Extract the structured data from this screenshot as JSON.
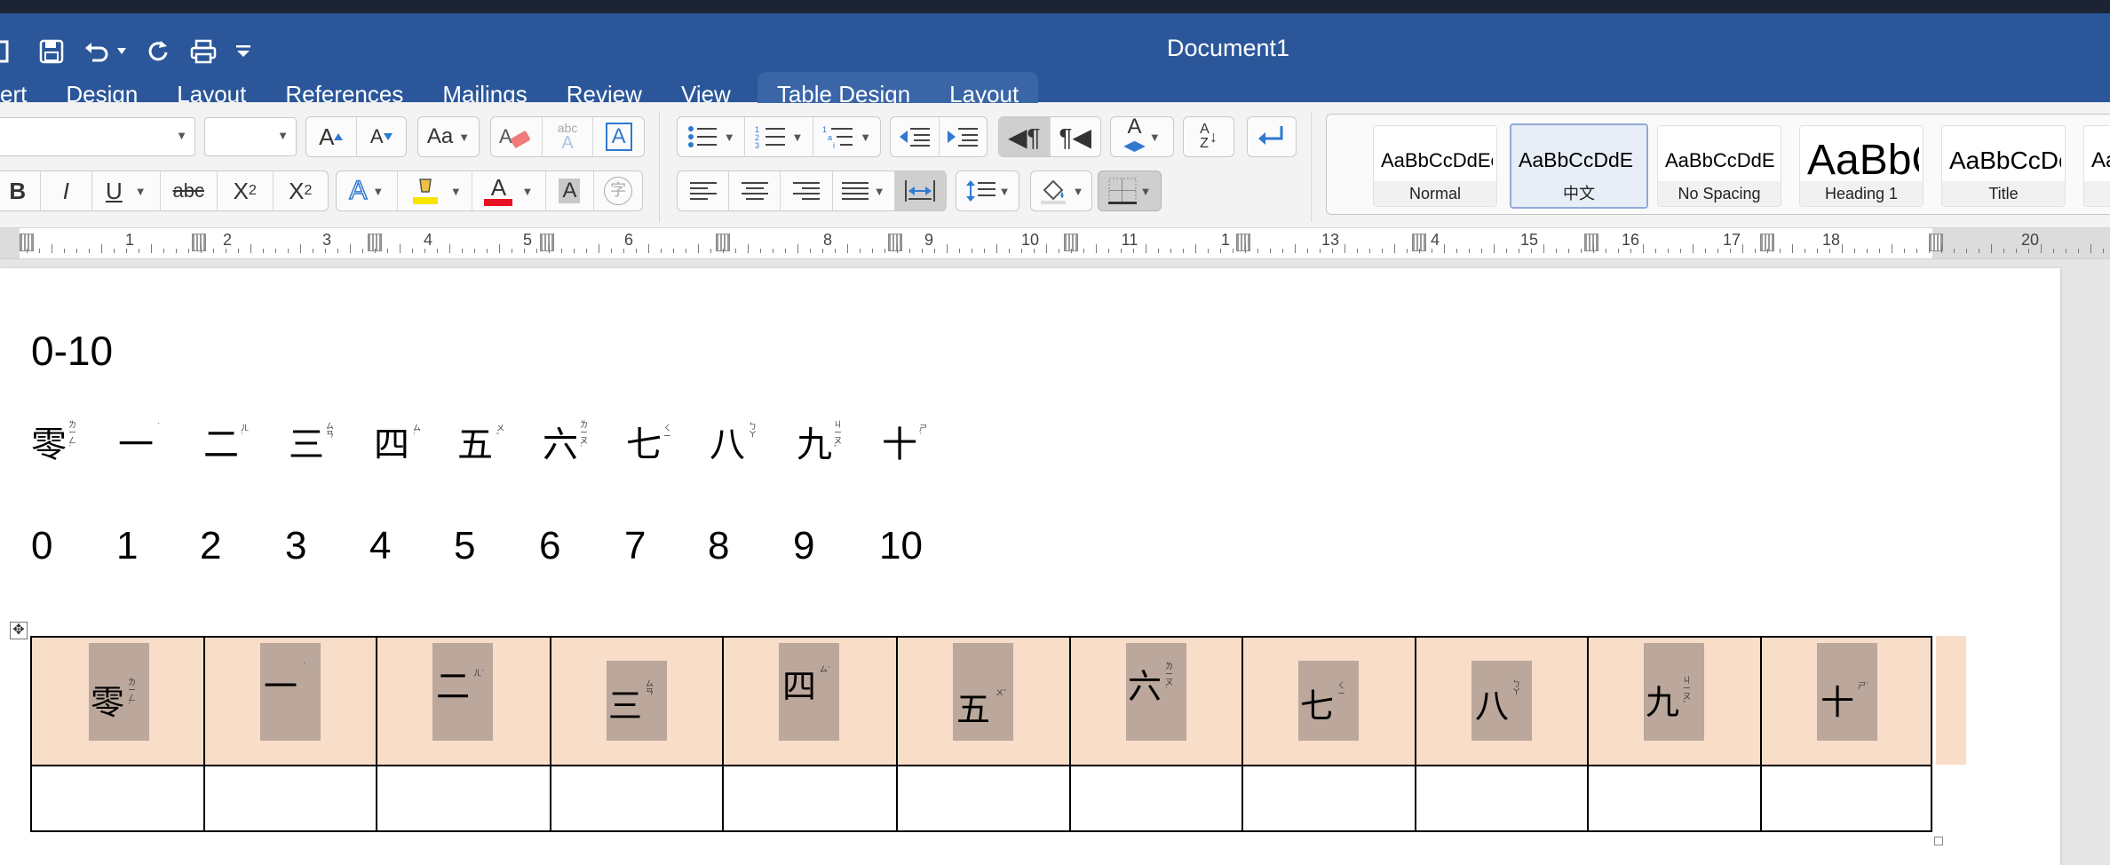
{
  "window": {
    "title": "Document1"
  },
  "tabs": [
    {
      "label": "ert"
    },
    {
      "label": "Design"
    },
    {
      "label": "Layout"
    },
    {
      "label": "References"
    },
    {
      "label": "Mailings"
    },
    {
      "label": "Review"
    },
    {
      "label": "View"
    },
    {
      "label": "Table Design"
    },
    {
      "label": "Layout"
    }
  ],
  "ribbon": {
    "grow_font": "A",
    "shrink_font": "A",
    "change_case": "Aa",
    "spelling_small": "abc",
    "spelling_big": "A",
    "text_box": "A",
    "bold": "B",
    "italic": "I",
    "underline": "U",
    "strikethrough": "abc",
    "subscript": "X",
    "subscript_mark": "2",
    "superscript": "X",
    "superscript_mark": "2",
    "text_effects": "A",
    "font_color": "A",
    "char_shading": "A",
    "enclose_char": "字",
    "sort": "A",
    "sort_to": "Z",
    "text_direction": "A",
    "colors": {
      "highlight": "#f7e400",
      "font_color": "#e81123",
      "accent": "#2b579a",
      "icon_blue": "#2f79d0"
    }
  },
  "styles": [
    {
      "sample": "AaBbCcDdEe",
      "name": "Normal"
    },
    {
      "sample": "AaBbCcDdE",
      "name": "中文"
    },
    {
      "sample": "AaBbCcDdE",
      "name": "No Spacing"
    },
    {
      "sample": "AaBbC",
      "name": "Heading 1"
    },
    {
      "sample": "AaBbCcDc",
      "name": "Title"
    },
    {
      "sample": "Aa",
      "name": ""
    }
  ],
  "ruler": {
    "numbers": [
      "1",
      "2",
      "3",
      "4",
      "5",
      "6",
      "8",
      "9",
      "10",
      "11",
      "1",
      "13",
      "4",
      "15",
      "16",
      "17",
      "18",
      "20"
    ]
  },
  "document": {
    "heading": "0-10",
    "chars": [
      {
        "ch": "零",
        "ann": "ㄌ ㄧ ㄥˊ"
      },
      {
        "ch": "一",
        "ann": "ˊ"
      },
      {
        "ch": "二",
        "ann": "ㄦˋ"
      },
      {
        "ch": "三",
        "ann": "ㄙ ㄢ"
      },
      {
        "ch": "四",
        "ann": "ㄙˋ"
      },
      {
        "ch": "五",
        "ann": "ㄨˇ"
      },
      {
        "ch": "六",
        "ann": "ㄌ ㄧ ㄡˋ"
      },
      {
        "ch": "七",
        "ann": "ㄑ ㄧ"
      },
      {
        "ch": "八",
        "ann": "ㄅ ㄚ"
      },
      {
        "ch": "九",
        "ann": "ㄐ ㄧ ㄡˇ"
      },
      {
        "ch": "十",
        "ann": "ㄕˊ"
      }
    ],
    "digits": [
      "0",
      "1",
      "2",
      "3",
      "4",
      "5",
      "6",
      "7",
      "8",
      "9",
      "10"
    ],
    "table_row1": [
      {
        "ch": "零",
        "ann": "ㄌ ㄧ ㄥˊ"
      },
      {
        "ch": "一",
        "ann": "ˊ"
      },
      {
        "ch": "二",
        "ann": "ㄦˋ"
      },
      {
        "ch": "三",
        "ann": "ㄙ ㄢ"
      },
      {
        "ch": "四",
        "ann": "ㄙˋ"
      },
      {
        "ch": "五",
        "ann": "ㄨˇ"
      },
      {
        "ch": "六",
        "ann": "ㄌ ㄧ ㄡˋ"
      },
      {
        "ch": "七",
        "ann": "ㄑ ㄧ"
      },
      {
        "ch": "八",
        "ann": "ㄅ ㄚ"
      },
      {
        "ch": "九",
        "ann": "ㄐ ㄧ ㄡˇ"
      },
      {
        "ch": "十",
        "ann": "ㄕˊ"
      }
    ],
    "colors": {
      "row_fill": "#f8ddc9",
      "char_shading": "#bba79b"
    }
  }
}
